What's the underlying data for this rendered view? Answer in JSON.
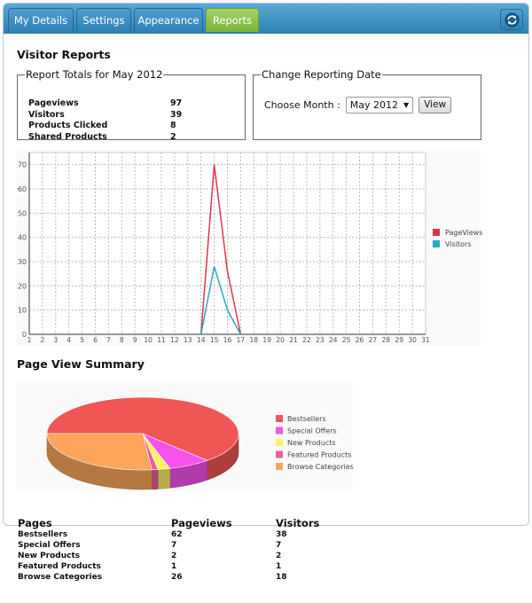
{
  "tabs": [
    {
      "label": "My Details",
      "active": false
    },
    {
      "label": "Settings",
      "active": false
    },
    {
      "label": "Appearance",
      "active": false
    },
    {
      "label": "Reports",
      "active": true
    }
  ],
  "page_title": "Visitor Reports",
  "totals": {
    "legend": "Report Totals for May 2012",
    "rows": [
      {
        "label": "Pageviews",
        "value": "97"
      },
      {
        "label": "Visitors",
        "value": "39"
      },
      {
        "label": "Products Clicked",
        "value": "8"
      },
      {
        "label": "Shared Products",
        "value": "2"
      }
    ]
  },
  "reporting_date": {
    "legend": "Change Reporting Date",
    "label": "Choose Month :",
    "selected": "May 2012",
    "button": "View"
  },
  "summary_title": "Page View Summary",
  "colors": {
    "pageviews": "#e0344a",
    "visitors": "#2aa7bf",
    "tab_active": "#7cb842",
    "tab": "#3d8dc2"
  },
  "chart_data": [
    {
      "type": "line",
      "x": [
        1,
        2,
        3,
        4,
        5,
        6,
        7,
        8,
        9,
        10,
        11,
        12,
        13,
        14,
        15,
        16,
        17,
        18,
        19,
        20,
        21,
        22,
        23,
        24,
        25,
        26,
        27,
        28,
        29,
        30,
        31
      ],
      "series": [
        {
          "name": "PageViews",
          "color": "#e0344a",
          "values": [
            0,
            0,
            0,
            0,
            0,
            0,
            0,
            0,
            0,
            0,
            0,
            0,
            0,
            0,
            70,
            26,
            0,
            0,
            0,
            0,
            0,
            0,
            0,
            0,
            0,
            0,
            0,
            0,
            0,
            0,
            0
          ]
        },
        {
          "name": "Visitors",
          "color": "#2aa7bf",
          "values": [
            0,
            0,
            0,
            0,
            0,
            0,
            0,
            0,
            0,
            0,
            0,
            0,
            0,
            0,
            28,
            10,
            0,
            0,
            0,
            0,
            0,
            0,
            0,
            0,
            0,
            0,
            0,
            0,
            0,
            0,
            0
          ]
        }
      ],
      "draw_from": 14,
      "draw_to": 17,
      "ylim": [
        0,
        75
      ],
      "yticks": [
        0,
        10,
        20,
        30,
        40,
        50,
        60,
        70
      ],
      "grid": true,
      "legend_position": "right"
    },
    {
      "type": "pie",
      "labels": [
        "Bestsellers",
        "Special Offers",
        "New Products",
        "Featured Products",
        "Browse Categories"
      ],
      "values": [
        62,
        7,
        2,
        1,
        26
      ],
      "colors": [
        "#f15656",
        "#f552ee",
        "#fbf262",
        "#ef5c9d",
        "#fba65c"
      ],
      "legend_position": "right"
    }
  ],
  "page_table": {
    "headers": [
      "Pages",
      "Pageviews",
      "Visitors"
    ],
    "rows": [
      [
        "Bestsellers",
        "62",
        "38"
      ],
      [
        "Special Offers",
        "7",
        "7"
      ],
      [
        "New Products",
        "2",
        "2"
      ],
      [
        "Featured Products",
        "1",
        "1"
      ],
      [
        "Browse Categories",
        "26",
        "18"
      ]
    ]
  }
}
